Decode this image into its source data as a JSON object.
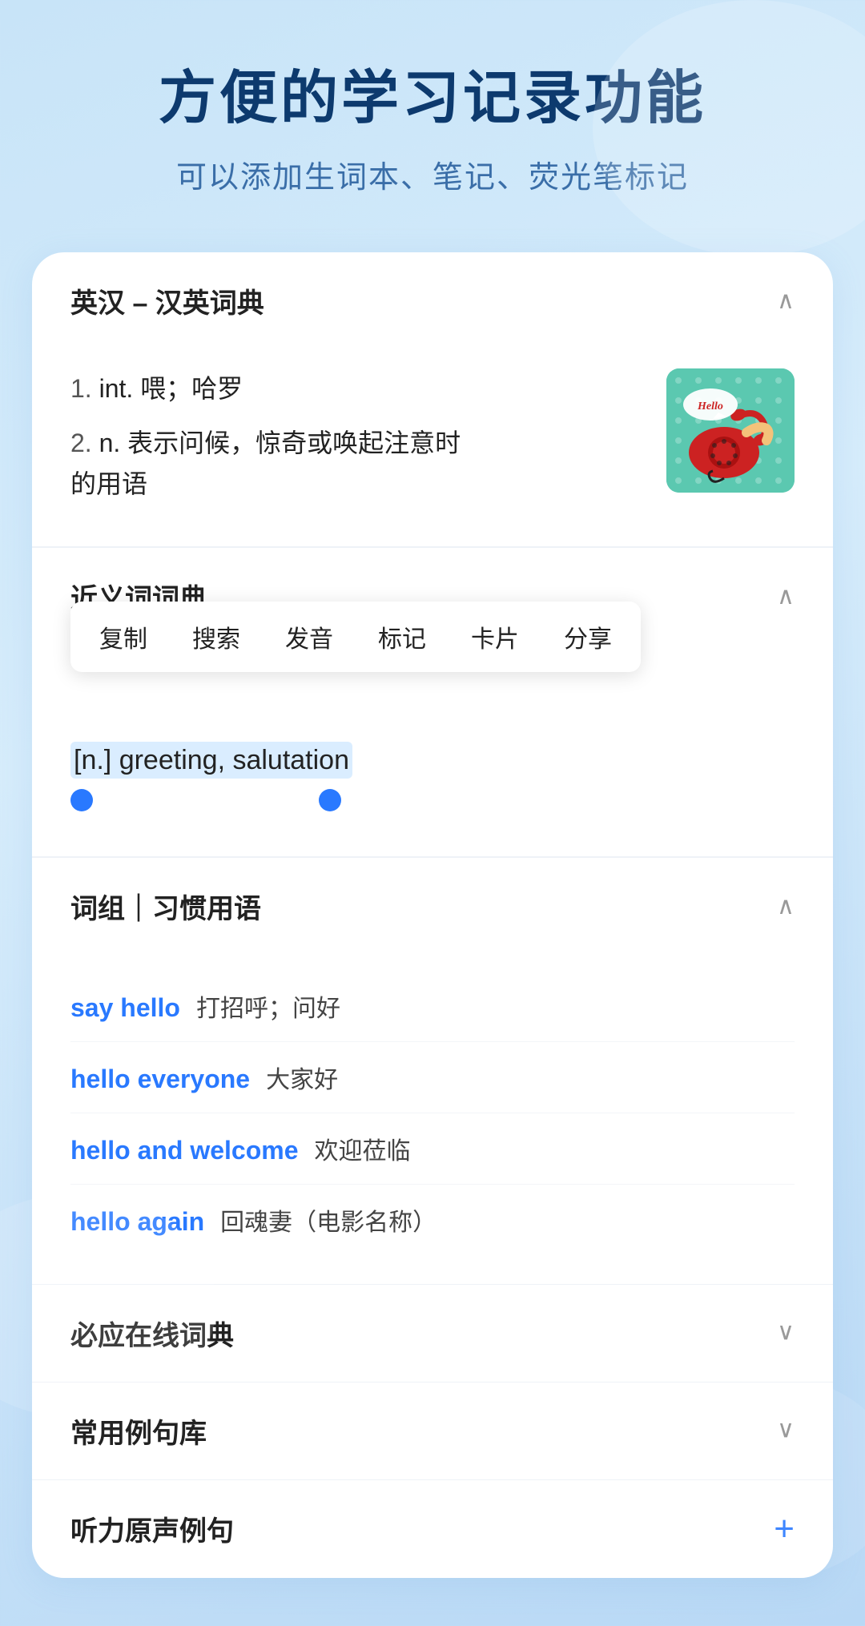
{
  "app": {
    "bg_color": "#c8e4f8"
  },
  "header": {
    "title": "方便的学习记录功能",
    "subtitle": "可以添加生词本、笔记、荧光笔标记"
  },
  "main_dict": {
    "section_title": "英汉 – 汉英词典",
    "chevron": "^",
    "definitions": [
      {
        "num": "1.",
        "pos": "int.",
        "text": "喂；哈罗"
      },
      {
        "num": "2.",
        "pos": "n.",
        "text": "表示问候，惊奇或唤起注意时的用语"
      }
    ]
  },
  "synonyms": {
    "section_title": "近义词词典",
    "chevron": "^",
    "context_menu": {
      "items": [
        "复制",
        "搜索",
        "发音",
        "标记",
        "卡片",
        "分享"
      ]
    },
    "selected_text": "[n.] greeting, salutation"
  },
  "phrases": {
    "section_title": "词组｜习惯用语",
    "chevron": "^",
    "items": [
      {
        "en": "say hello",
        "zh": "打招呼；问好"
      },
      {
        "en": "hello everyone",
        "zh": "大家好"
      },
      {
        "en": "hello and welcome",
        "zh": "欢迎莅临"
      },
      {
        "en": "hello again",
        "zh": "回魂妻（电影名称）"
      }
    ]
  },
  "collapsed_sections": [
    {
      "title": "必应在线词典",
      "icon": "chevron-down"
    },
    {
      "title": "常用例句库",
      "icon": "chevron-down"
    },
    {
      "title": "听力原声例句",
      "icon": "plus"
    }
  ]
}
